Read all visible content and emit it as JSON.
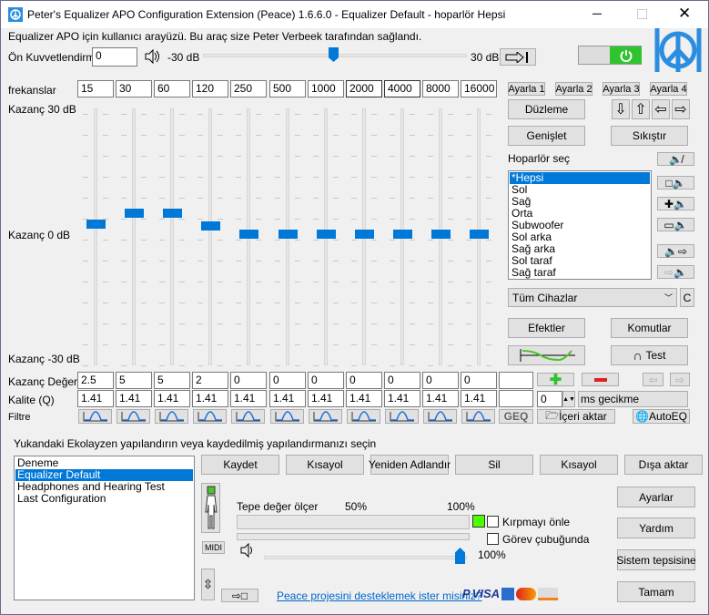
{
  "window": {
    "title": "Peter's Equalizer APO Configuration Extension (Peace) 1.6.6.0 - Equalizer Default - hoparlör Hepsi"
  },
  "header": {
    "subtitle": "Equalizer APO için kullanıcı arayüzü. Bu araç size Peter Verbeek tarafından sağlandı.",
    "preamp_label": "Ön Kuvvetlendirme",
    "preamp_value": "0",
    "min_label": "-30 dB",
    "max_label": "30 dB",
    "preamp_fraction": 0.5,
    "power_on": true
  },
  "eq": {
    "freq_label": "frekanslar",
    "frequencies": [
      "15",
      "30",
      "60",
      "120",
      "250",
      "500",
      "1000",
      "2000",
      "4000",
      "8000",
      "16000"
    ],
    "gain_top": "Kazanç 30 dB",
    "gain_mid": "Kazanç 0 dB",
    "gain_bottom": "Kazanç -30 dB",
    "gain_label": "Kazanç Değeri",
    "gains": [
      "2.5",
      "5",
      "5",
      "2",
      "0",
      "0",
      "0",
      "0",
      "0",
      "0",
      "0"
    ],
    "q_label": "Kalite (Q)",
    "qs": [
      "1.41",
      "1.41",
      "1.41",
      "1.41",
      "1.41",
      "1.41",
      "1.41",
      "1.41",
      "1.41",
      "1.41",
      "1.41"
    ],
    "filter_label": "Filtre",
    "geq": "GEQ",
    "import": "İçeri aktar",
    "autoeq": "AutoEQ",
    "delay_value": "0",
    "delay_label": "ms gecikme"
  },
  "right": {
    "presets": [
      "Ayarla 1",
      "Ayarla 2",
      "Ayarla 3",
      "Ayarla 4"
    ],
    "flatten": "Düzleme",
    "expand": "Genişlet",
    "compress": "Sıkıştır",
    "speaker_label": "Hoparlör seç",
    "speakers": [
      "*Hepsi",
      "Sol",
      "Sağ",
      "Orta",
      "Subwoofer",
      "Sol arka",
      "Sağ arka",
      "Sol taraf",
      "Sağ taraf"
    ],
    "selected_speaker": "*Hepsi",
    "device": "Tüm Cihazlar",
    "c": "C",
    "effects": "Efektler",
    "commands": "Komutlar",
    "test": "Test"
  },
  "bottom": {
    "prompt": "Yukandaki Ekolayzen  yapılandırın veya kaydedilmiş yapılandırmanızı seçin",
    "configs": [
      "Deneme",
      "Equalizer Default",
      "Headphones and Hearing Test",
      "Last Configuration"
    ],
    "selected_config": "Equalizer Default",
    "buttons": [
      "Kaydet",
      "Kısayol",
      "Yeniden Adlandır",
      "Sil",
      "Kısayol",
      "Dışa aktar"
    ],
    "meter_label": "Tepe değer ölçer",
    "p50": "50%",
    "p100": "100%",
    "clip": "Kırpmayı önle",
    "taskbar": "Görev çubuğunda",
    "volume_value": "100%",
    "volume_fraction": 1.0,
    "midi": "MIDI",
    "link": "Peace projesini desteklemek ister misiniz?",
    "pay": "VISA",
    "settings": "Ayarlar",
    "help": "Yardım",
    "tray": "Sistem tepsisine",
    "ok": "Tamam"
  }
}
